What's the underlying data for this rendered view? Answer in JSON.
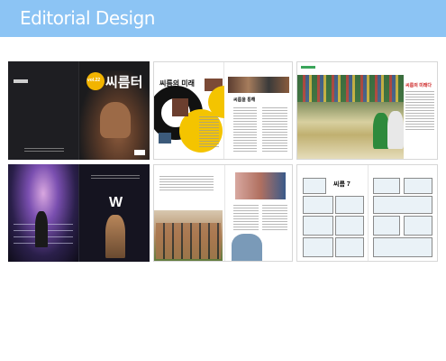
{
  "header": {
    "title": "Editorial Design"
  },
  "colors": {
    "header_bg": "#8cc4f4",
    "accent_yellow": "#f4c400",
    "accent_green": "#3aa55a",
    "dark_bg": "#1b1b1d"
  },
  "spreads": {
    "cover": {
      "vol": "vol.22",
      "title": "씨름터"
    },
    "spread2": {
      "headline": "씨름의 미래",
      "subhead": "씨름을 통해"
    },
    "spread3": {
      "headline": "씨름의 미래다"
    },
    "spread4": {
      "logo": "W"
    },
    "spread6": {
      "headline": "씨름 7"
    }
  }
}
